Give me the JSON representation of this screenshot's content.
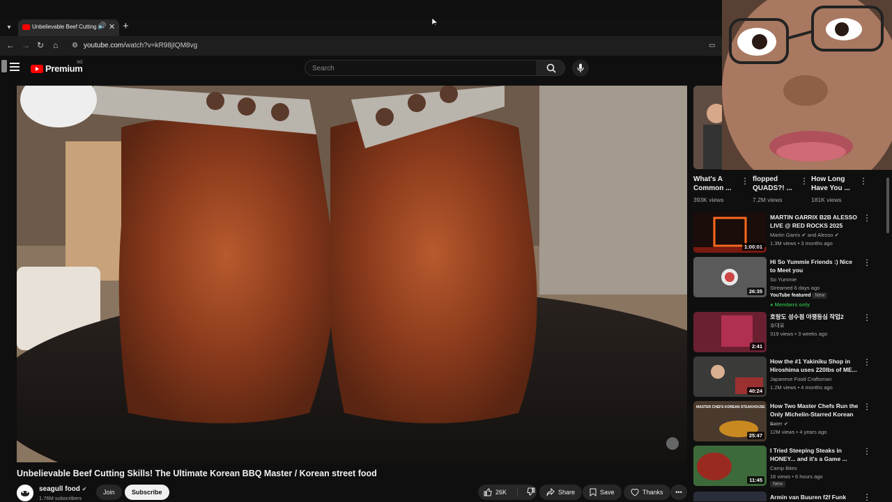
{
  "browser": {
    "tab_title": "Unbelievable Beef Cutting S",
    "url_domain": "youtube.com",
    "url_path": "/watch?v=kR98jIQM8vg"
  },
  "header": {
    "logo_text": "Premium",
    "logo_sup": "SG",
    "search_placeholder": "Search"
  },
  "video": {
    "title": "Unbelievable Beef Cutting Skills! The Ultimate Korean BBQ Master / Korean street food",
    "channel": "seagull food",
    "subscribers": "1.76M subscribers",
    "join_label": "Join",
    "subscribe_label": "Subscribe",
    "likes": "26K",
    "share_label": "Share",
    "save_label": "Save",
    "thanks_label": "Thanks"
  },
  "shorts": [
    {
      "title": "What's A Common ...",
      "views": "393K views"
    },
    {
      "title": "flopped QUADS?! ...",
      "views": "7.2M views"
    },
    {
      "title": "How Long Have You ...",
      "views": "181K views"
    }
  ],
  "recommendations": [
    {
      "title": "MARTIN GARRIX B2B ALESSO LIVE @ RED ROCKS 2025",
      "channel": "Martin Garrix ✔ and Alesso ✔",
      "meta": "1.3M views • 3 months ago",
      "duration": "1:00:01"
    },
    {
      "title": "Hi So Yummie Friends :) Nice to Meet you",
      "channel": "So Yummie",
      "meta": "Streamed 6 days ago",
      "featured": "YouTube featured",
      "new": "New",
      "members": "Members only",
      "duration": "26:35"
    },
    {
      "title": "호랑도 성수점 야쟁등심 작업2",
      "channel": "호대표",
      "meta": "319 views • 3 weeks ago",
      "duration": "2:41"
    },
    {
      "title": "How the #1 Yakiniku Shop in Hiroshima uses 220lbs of ME...",
      "channel": "Japanese Food Craftsman",
      "meta": "1.2M views • 4 months ago",
      "duration": "40:24"
    },
    {
      "title": "How Two Master Chefs Run the Only Michelin-Starred Korean ...",
      "channel": "Eater ✔",
      "meta": "12M views • 4 years ago",
      "duration": "25:47",
      "thumb_text": "MASTER CHEFS KOREAN STEAKHOUSE"
    },
    {
      "title": "I Tried Steeping Steaks in HONEY... and it's a Game ...",
      "channel": "Camp Bites",
      "meta": "16 views • 6 hours ago",
      "new": "New",
      "duration": "11:45"
    },
    {
      "title": "Armin van Buuren f2f Funk"
    }
  ]
}
